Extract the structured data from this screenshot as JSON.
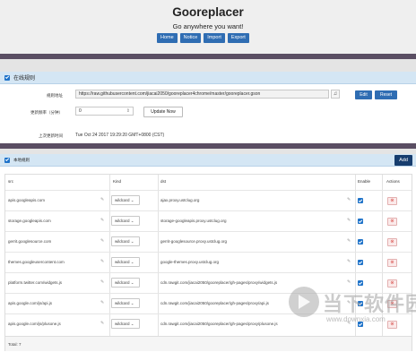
{
  "header": {
    "title": "Gooreplacer",
    "subtitle": "Go anywhere you want!",
    "nav": [
      "Home",
      "Notice",
      "Import",
      "Export"
    ]
  },
  "online_rules": {
    "section_title": "在线规则",
    "rule_url_label": "规则地址",
    "rule_url_value": "https://raw.githubusercontent.com/jiacai2050/gooreplacer4chrome/master/gooreplacer.gson",
    "edit_label": "Edit",
    "reset_label": "Reset",
    "freq_label": "更新频率（分钟）",
    "freq_value": "0",
    "update_now_label": "Update Now",
    "last_update_label": "上次更新时间",
    "last_update_value": "Tue Oct 24 2017 19:29:20 GMT+0800 (CST)"
  },
  "local_rules": {
    "section_title": "本地规则",
    "add_label": "Add",
    "columns": {
      "src": "src",
      "kind": "Kind",
      "dst": "dst",
      "enable": "Enable",
      "actions": "Actions"
    },
    "rows": [
      {
        "src": "apis.googleapis.com",
        "kind": "wildcard",
        "dst": "ajax.proxy.ustclug.org",
        "enabled": true
      },
      {
        "src": "storage.googleapis.com",
        "kind": "wildcard",
        "dst": "storage-googleapis.proxy.ustclug.org",
        "enabled": true
      },
      {
        "src": "gerrit.googlesource.com",
        "kind": "wildcard",
        "dst": "gerrit-googlesource.proxy.ustclug.org",
        "enabled": true
      },
      {
        "src": "themes.googleusercontent.com",
        "kind": "wildcard",
        "dst": "google-themes.proxy.ustclug.org",
        "enabled": true
      },
      {
        "src": "platform.twitter.com/widgets.js",
        "kind": "wildcard",
        "dst": "cdn.rawgit.com/jiacai2050/gooreplacer/gh-pages/proxy/widgets.js",
        "enabled": true
      },
      {
        "src": "apis.google.com/js/api.js",
        "kind": "wildcard",
        "dst": "cdn.rawgit.com/jiacai2050/gooreplacer/gh-pages/proxy/api.js",
        "enabled": true
      },
      {
        "src": "apis.google.com/js/plusone.js",
        "kind": "wildcard",
        "dst": "cdn.rawgit.com/jiacai2050/gooreplacer/gh-pages/proxy/plusone.js",
        "enabled": true
      }
    ],
    "total_label": "Total: 7"
  },
  "watermark": {
    "text": "当下软件园",
    "url": "www.downxia.com"
  },
  "colors": {
    "accent": "#2f6db3",
    "panel_header": "#d4e6f4",
    "divider": "#5a4e63",
    "danger": "#d9534f"
  }
}
